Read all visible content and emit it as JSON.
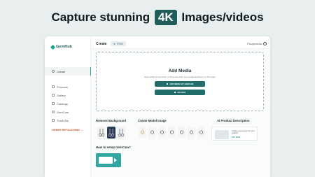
{
  "headline": {
    "before": "Capture stunning",
    "badge": "4K",
    "after": "Images/videos"
  },
  "colors": {
    "accent": "#22a08f",
    "brand_dark": "#1f5c5a",
    "order_cta": "#c2552d"
  },
  "sidebar": {
    "logo": "GemHub",
    "items": [
      {
        "label": "Create",
        "icon": "create-icon",
        "active": true
      },
      {
        "label": "Products",
        "icon": "products-icon"
      },
      {
        "label": "Gallery",
        "icon": "gallery-icon"
      },
      {
        "label": "Catalogs",
        "icon": "catalogs-icon"
      },
      {
        "label": "GemCam",
        "icon": "gemcam-icon"
      },
      {
        "label": "Trash Bin",
        "icon": "trash-icon"
      }
    ],
    "order_button": "ORDER RETOUCHING →"
  },
  "topbar": {
    "title": "Create",
    "badge": "FREE",
    "user": "Picupmedia"
  },
  "upload": {
    "title": "Add Media",
    "subtitle": "Add media by GemCam or drag and drop your media anywhere on this page",
    "gemcam_button": "ADD MEDIA BY GEMCAM",
    "upload_button": "UPLOAD"
  },
  "sections": {
    "remove_background": "Remove Background",
    "create_model": "Create Model Image",
    "ai_description": "AI Product Description",
    "setup": "How to setup GemCam?"
  },
  "ai_card": {
    "text": "Create a description for your product",
    "try_now": "TRY NOW"
  }
}
